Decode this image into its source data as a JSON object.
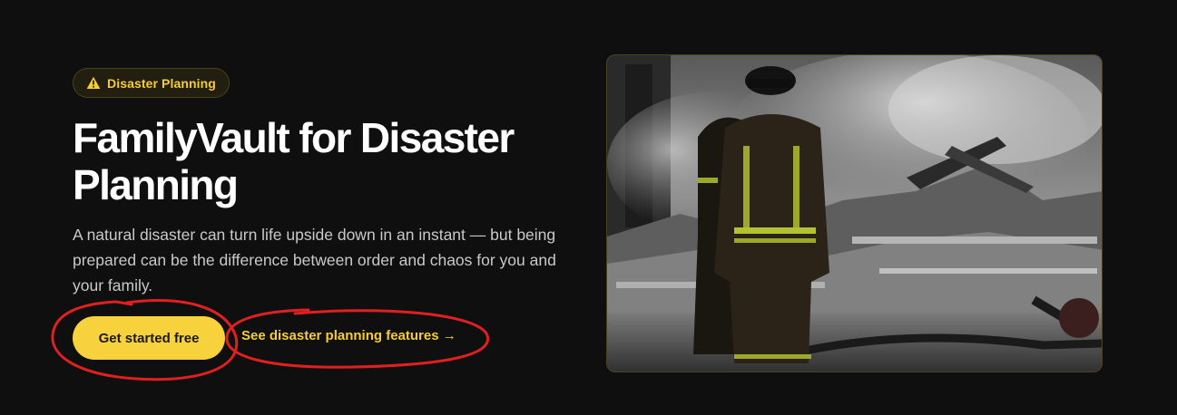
{
  "badge": {
    "icon": "warning-icon",
    "label": "Disaster Planning",
    "accent_color": "#f6cc35"
  },
  "hero": {
    "title": "FamilyVault for Disaster Planning",
    "description": "A natural disaster can turn life upside down in an instant — but being prepared can be the difference between order and chaos for you and your family.",
    "primary_cta": "Get started free",
    "secondary_cta": "See disaster planning features →",
    "image_alt": "Firefighters standing in front of smoking, ice-covered rubble"
  },
  "colors": {
    "background": "#0f0f0f",
    "accent": "#f8d23c",
    "annotation": "#e02020"
  }
}
